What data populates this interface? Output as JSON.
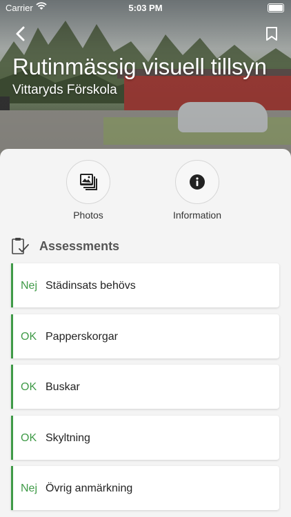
{
  "status_bar": {
    "carrier": "Carrier",
    "time": "5:03 PM"
  },
  "header": {
    "title": "Rutinmässig visuell tillsyn",
    "subtitle": "Vittaryds Förskola",
    "back_icon": "chevron-left-icon",
    "bookmark_icon": "bookmark-icon"
  },
  "actions": [
    {
      "label": "Photos",
      "icon": "photos-icon"
    },
    {
      "label": "Information",
      "icon": "info-icon"
    }
  ],
  "assessments": {
    "heading": "Assessments",
    "icon": "clipboard-check-icon",
    "accent_color": "#3f9a47",
    "items": [
      {
        "status": "Nej",
        "label": "Städinsats behövs"
      },
      {
        "status": "OK",
        "label": "Papperskorgar"
      },
      {
        "status": "OK",
        "label": "Buskar"
      },
      {
        "status": "OK",
        "label": "Skyltning"
      },
      {
        "status": "Nej",
        "label": "Övrig anmärkning"
      }
    ]
  }
}
